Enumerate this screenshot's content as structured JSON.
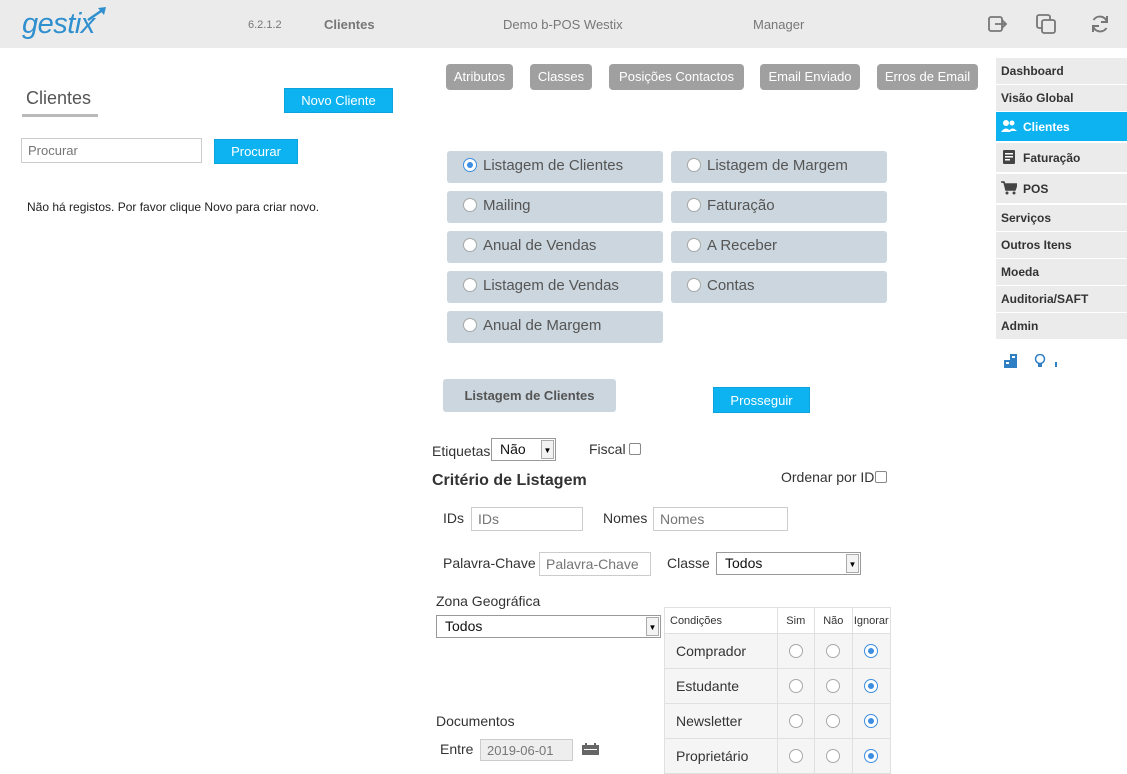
{
  "topbar": {
    "logo": "gestix",
    "version": "6.2.1.2",
    "module": "Clientes",
    "company": "Demo b-POS Westix",
    "user": "Manager",
    "icons": [
      "logout-icon",
      "windows-icon",
      "refresh-icon"
    ]
  },
  "left": {
    "title": "Clientes",
    "new_button": "Novo Cliente",
    "search_placeholder": "Procurar",
    "search_button": "Procurar",
    "empty_message": "Não há registos. Por favor clique Novo para criar novo."
  },
  "top_buttons": [
    "Atributos",
    "Classes",
    "Posições Contactos",
    "Email Enviado",
    "Erros de Email"
  ],
  "reports": {
    "left": [
      "Listagem de Clientes",
      "Mailing",
      "Anual de Vendas",
      "Listagem de Vendas",
      "Anual de Margem"
    ],
    "right": [
      "Listagem de Margem",
      "Faturação",
      "A Receber",
      "Contas"
    ],
    "selected": "Listagem de Clientes",
    "selected_label": "Listagem de Clientes",
    "proceed_button": "Prosseguir"
  },
  "form": {
    "labels_label": "Etiquetas",
    "labels_value": "Não",
    "fiscal_label": "Fiscal",
    "criteria_title": "Critério de Listagem",
    "order_by_id_label": "Ordenar por ID",
    "ids_label": "IDs",
    "ids_placeholder": "IDs",
    "names_label": "Nomes",
    "names_placeholder": "Nomes",
    "keyword_label": "Palavra-Chave",
    "keyword_placeholder": "Palavra-Chave",
    "class_label": "Classe",
    "class_value": "Todos",
    "zone_label": "Zona Geográfica",
    "zone_value": "Todos",
    "documents_label": "Documentos",
    "between_label": "Entre",
    "start_date": "2019-06-01"
  },
  "conditions": {
    "headers": [
      "Condições",
      "Sim",
      "Não",
      "Ignorar"
    ],
    "rows": [
      {
        "name": "Comprador",
        "value": "Ignorar"
      },
      {
        "name": "Estudante",
        "value": "Ignorar"
      },
      {
        "name": "Newsletter",
        "value": "Ignorar"
      },
      {
        "name": "Proprietário",
        "value": "Ignorar"
      }
    ]
  },
  "sidebar": {
    "items": [
      {
        "label": "Dashboard",
        "icon": ""
      },
      {
        "label": "Visão Global",
        "icon": ""
      },
      {
        "label": "Clientes",
        "icon": "users-icon",
        "active": true
      },
      {
        "label": "Faturação",
        "icon": "document-icon"
      },
      {
        "label": "POS",
        "icon": "cart-icon"
      },
      {
        "label": "Serviços",
        "icon": ""
      },
      {
        "label": "Outros Itens",
        "icon": ""
      },
      {
        "label": "Moeda",
        "icon": ""
      },
      {
        "label": "Auditoria/SAFT",
        "icon": ""
      },
      {
        "label": "Admin",
        "icon": ""
      }
    ]
  },
  "colors": {
    "accent": "#0cb3f0",
    "logo": "#2f8fcf",
    "option_bg": "#cbd6de",
    "gray_button": "#a0a0a0",
    "radio_selected": "#3d8de0"
  }
}
